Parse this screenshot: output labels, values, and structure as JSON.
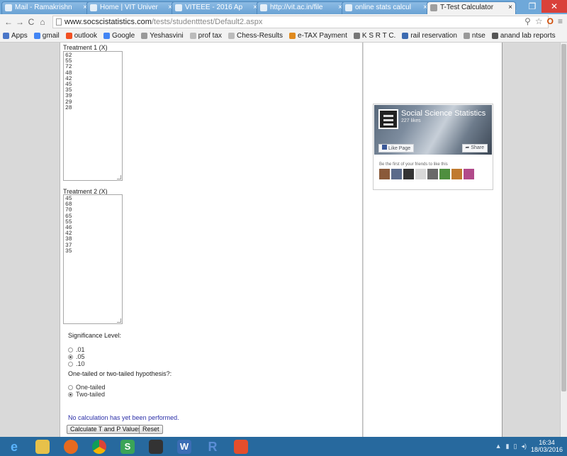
{
  "browser": {
    "tabs": [
      {
        "label": "Mail - Ramakrishn",
        "active": false
      },
      {
        "label": "Home | VIT Univer",
        "active": false
      },
      {
        "label": "VITEEE - 2016 Ap",
        "active": false
      },
      {
        "label": "http://vit.ac.in/file",
        "active": false
      },
      {
        "label": "online stats calcul",
        "active": false
      },
      {
        "label": "T-Test Calculator",
        "active": true
      }
    ],
    "tab_close_glyph": "×",
    "window_controls": {
      "minimize": "_",
      "maximize": "❐",
      "close": "✕"
    },
    "nav": {
      "back": "←",
      "forward": "→",
      "reload": "C",
      "home": "⌂"
    },
    "url_host": "www.socscistatistics.com",
    "url_path": "/tests/studentttest/Default2.aspx"
  },
  "bookmarks": [
    {
      "label": "Apps",
      "color": "#4a76c8"
    },
    {
      "label": "gmail",
      "color": "#4285f4"
    },
    {
      "label": "outlook",
      "color": "#f25022"
    },
    {
      "label": "Google",
      "color": "#4285f4"
    },
    {
      "label": "Yeshasvini",
      "color": "#999999"
    },
    {
      "label": "prof tax",
      "color": "#bbbbbb"
    },
    {
      "label": "Chess-Results",
      "color": "#bbbbbb"
    },
    {
      "label": "e-TAX Payment",
      "color": "#e08a1e"
    },
    {
      "label": "K S R T C.",
      "color": "#777777"
    },
    {
      "label": "rail reservation",
      "color": "#3c6ab0"
    },
    {
      "label": "ntse",
      "color": "#999999"
    },
    {
      "label": "anand lab reports",
      "color": "#555555"
    }
  ],
  "form": {
    "treatment1_label": "Treatment 1 (X)",
    "treatment1_values": [
      "62",
      "55",
      "72",
      "48",
      "42",
      "45",
      "35",
      "39",
      "29",
      "28"
    ],
    "treatment2_label": "Treatment 2 (X)",
    "treatment2_values": [
      "45",
      "68",
      "70",
      "65",
      "55",
      "46",
      "42",
      "38",
      "37",
      "35"
    ],
    "significance_label": "Significance Level:",
    "significance_options": [
      {
        "label": ".01",
        "checked": false
      },
      {
        "label": ".05",
        "checked": true
      },
      {
        "label": ".10",
        "checked": false
      }
    ],
    "tail_label": "One-tailed or two-tailed hypothesis?:",
    "tail_options": [
      {
        "label": "One-tailed",
        "checked": false
      },
      {
        "label": "Two-tailed",
        "checked": true
      }
    ],
    "status_text": "No calculation has yet been performed.",
    "calculate_label": "Calculate T and P Values",
    "reset_label": "Reset"
  },
  "facebook_widget": {
    "page_name": "Social Science Statistics",
    "likes": "227 likes",
    "like_page_label": "Like Page",
    "share_label": "Share",
    "friends_text": "Be the first of your friends to like this"
  },
  "taskbar": {
    "icons": [
      "ie-icon",
      "file-explorer-icon",
      "firefox-icon",
      "chrome-icon",
      "app-s-icon",
      "printer-icon",
      "word-icon",
      "r-icon",
      "video-icon"
    ],
    "time": "16:34",
    "date": "18/03/2016"
  }
}
